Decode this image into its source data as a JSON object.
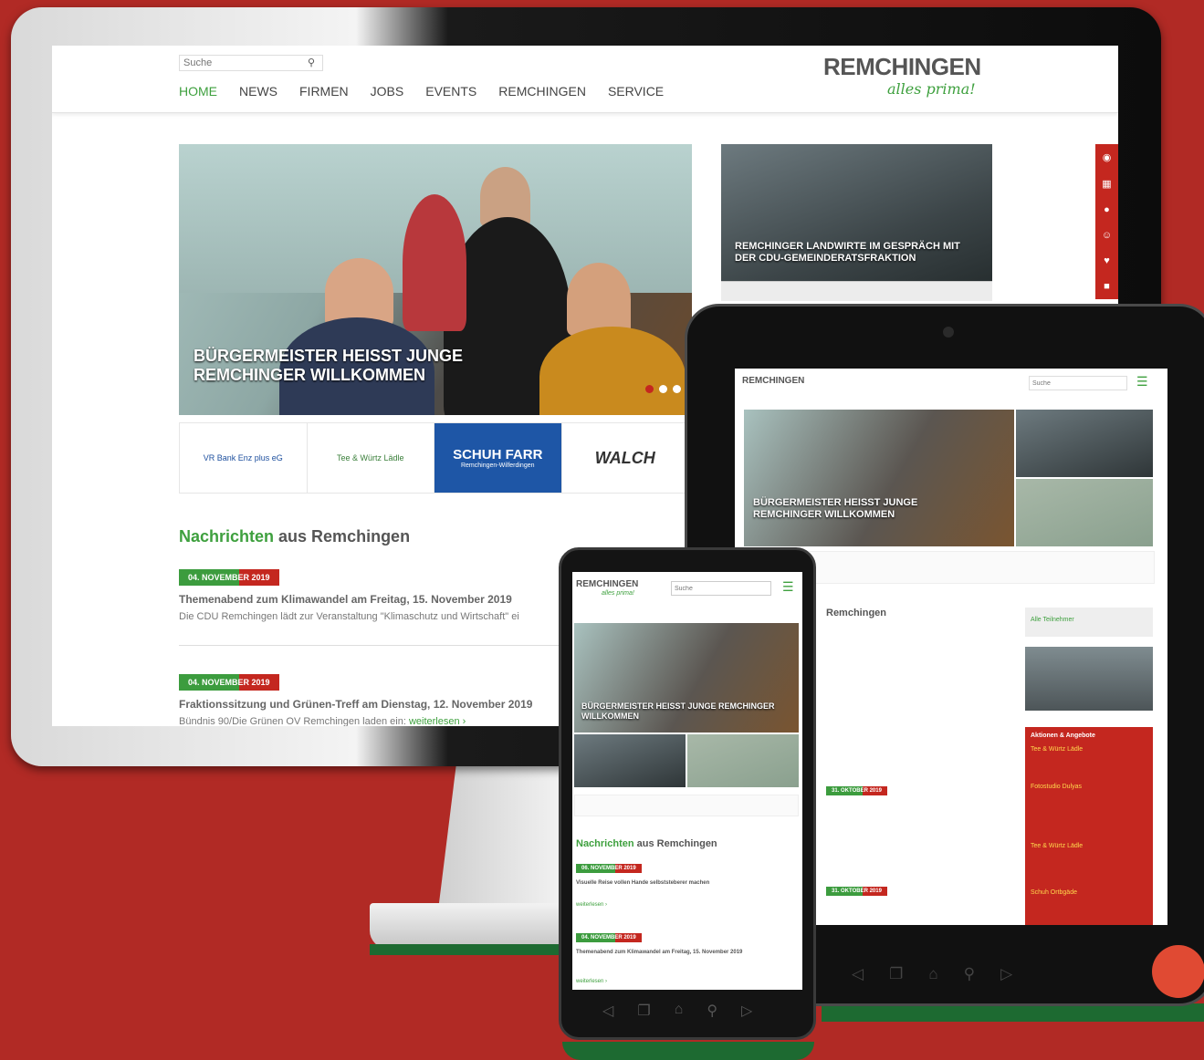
{
  "desktop": {
    "search_placeholder": "Suche",
    "nav": [
      "HOME",
      "NEWS",
      "FIRMEN",
      "JOBS",
      "EVENTS",
      "REMCHINGEN",
      "SERVICE"
    ],
    "logo": "REMCHINGEN",
    "tagline": "alles prima!",
    "hero_title": "BÜRGERMEISTER HEISST JUNGE REMCHINGER WILLKOMMEN",
    "side_title": "REMCHINGER LANDWIRTE IM GESPRÄCH MIT DER CDU-GEMEINDERATSFRAKTION",
    "sponsors": [
      "VR Bank Enz plus eG",
      "Tee & Würtz Lädle",
      "SCHUH FARR",
      "WALCH"
    ],
    "sponsor_schuh_sub": "Remchingen-Wilferdingen",
    "news_heading_green": "Nachrichten",
    "news_heading_rest": " aus Remchingen",
    "news": [
      {
        "date": "04. NOVEMBER 2019",
        "title": "Themenabend zum Klimawandel am Freitag, 15. November 2019",
        "text": "Die CDU Remchingen lädt zur Veranstaltung \"Klimaschutz und Wirtschaft\" ei"
      },
      {
        "date": "04. NOVEMBER 2019",
        "title": "Fraktionssitzung und Grünen-Treff am Dienstag, 12. November 2019",
        "text": "Bündnis 90/Die Grünen OV Remchingen laden ein: ",
        "more": "weiterlesen ›"
      }
    ]
  },
  "tablet": {
    "logo": "REMCHINGEN",
    "search_placeholder": "Suche",
    "hero_title": "BÜRGERMEISTER HEISST JUNGE REMCHINGER WILLKOMMEN",
    "news_heading": "Remchingen",
    "dates": [
      "31. OKTOBER 2019",
      "31. OKTOBER 2019"
    ],
    "sidebar_box": "Alle Teilnehmer",
    "offers_heading": "Aktionen & Angebote",
    "offers": [
      "Tee & Würtz Lädle",
      "Fotostudio Dulyas",
      "Tee & Würtz Lädle",
      "Schuh Ortbgäde"
    ]
  },
  "phone": {
    "logo": "REMCHINGEN",
    "tagline": "alles prima!",
    "search_placeholder": "Suche",
    "hero_title": "BÜRGERMEISTER HEISST JUNGE REMCHINGER WILLKOMMEN",
    "news_heading_green": "Nachrichten",
    "news_heading_rest": " aus Remchingen",
    "news": [
      {
        "date": "06. NOVEMBER 2019",
        "title": "Visuelle Reise vollen Hande selbststeberer machen",
        "more": "weiterlesen ›"
      },
      {
        "date": "04. NOVEMBER 2019",
        "title": "Themenabend zum Klimawandel am Freitag, 15. November 2019",
        "more": "weiterlesen ›"
      }
    ]
  },
  "colors": {
    "background": "#b12a25",
    "accent_green": "#3ea03e",
    "accent_red": "#c4271f",
    "dark_green": "#1d6a31"
  }
}
